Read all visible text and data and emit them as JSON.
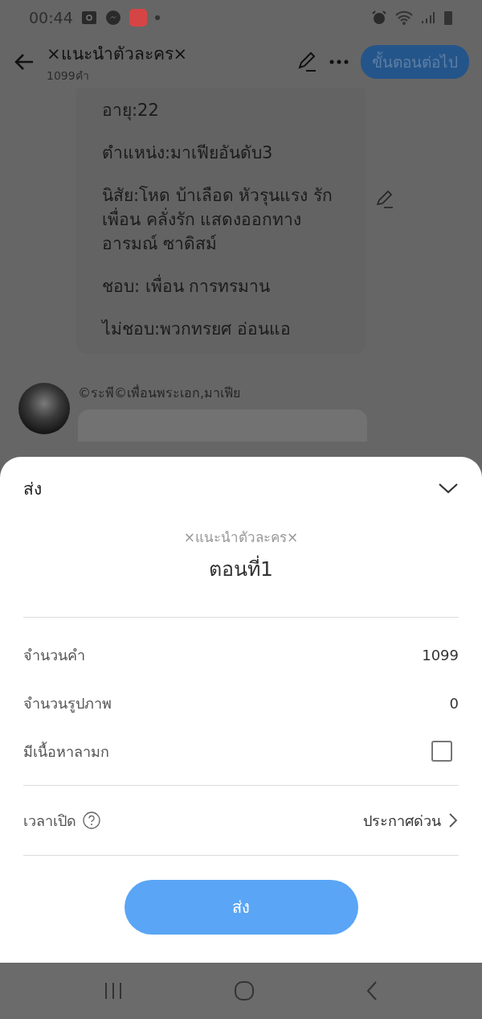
{
  "status_bar": {
    "time": "00:44"
  },
  "header": {
    "title": "×แนะนำตัวละคร×",
    "subtitle": "1099คำ",
    "next_button": "ขั้นตอนต่อไป"
  },
  "content": {
    "bio_lines": [
      "อายุ:22",
      "ตำแหน่ง:มาเฟียอันดับ3",
      "นิสัย:โหด บ้าเลือด หัวรุนแรง รักเพื่อน คลั่งรัก  แสดงออกทางอารมณ์ ซาดิสม์",
      "ชอบ: เพื่อน การทรมาน",
      "ไม่ชอบ:พวกทรยศ อ่อนแอ"
    ],
    "next_character": {
      "name": "©ระพี©เพื่อนพระเอก,มาเฟีย"
    }
  },
  "sheet": {
    "title": "ส่ง",
    "work_title": "×แนะนำตัวละคร×",
    "chapter": "ตอนที่1",
    "rows": [
      {
        "kind": "value",
        "label": "จำนวนคำ",
        "value": "1099"
      },
      {
        "kind": "value",
        "label": "จำนวนรูปภาพ",
        "value": "0"
      },
      {
        "kind": "checkbox",
        "label": "มีเนื้อหาลามก",
        "checked": false
      }
    ],
    "open_time": {
      "label": "เวลาเปิด",
      "value": "ประกาศด่วน"
    },
    "submit": "ส่ง"
  }
}
